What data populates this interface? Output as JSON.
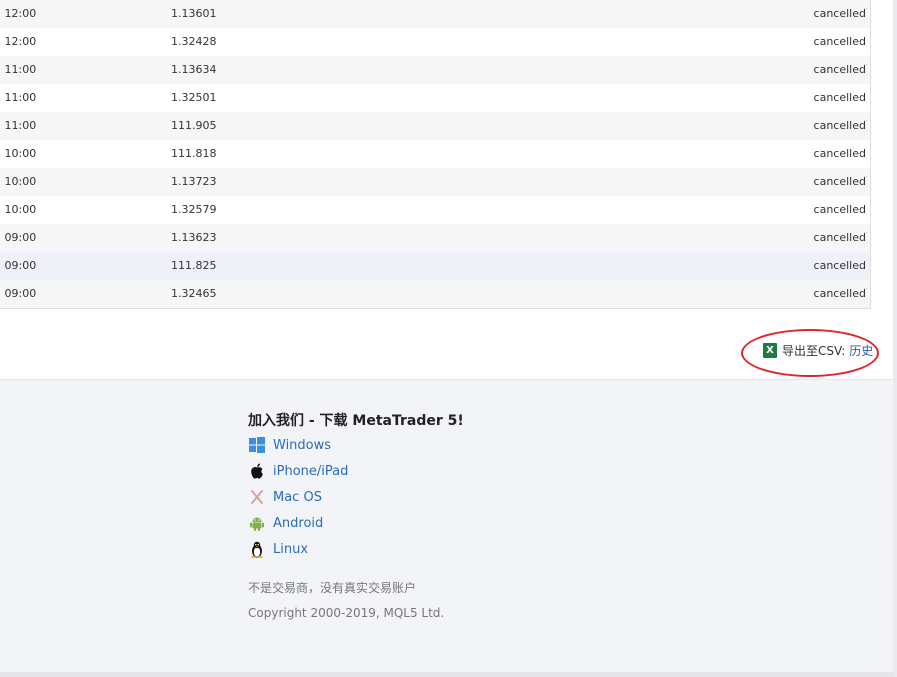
{
  "table": {
    "rows": [
      {
        "time": "1 12:00",
        "price": "1.13601",
        "status": "cancelled"
      },
      {
        "time": "1 12:00",
        "price": "1.32428",
        "status": "cancelled"
      },
      {
        "time": "1 11:00",
        "price": "1.13634",
        "status": "cancelled"
      },
      {
        "time": "1 11:00",
        "price": "1.32501",
        "status": "cancelled"
      },
      {
        "time": "1 11:00",
        "price": "111.905",
        "status": "cancelled"
      },
      {
        "time": "1 10:00",
        "price": "111.818",
        "status": "cancelled"
      },
      {
        "time": "1 10:00",
        "price": "1.13723",
        "status": "cancelled"
      },
      {
        "time": "1 10:00",
        "price": "1.32579",
        "status": "cancelled"
      },
      {
        "time": "1 09:00",
        "price": "1.13623",
        "status": "cancelled"
      },
      {
        "time": "1 09:00",
        "price": "111.825",
        "status": "cancelled"
      },
      {
        "time": "1 09:00",
        "price": "1.32465",
        "status": "cancelled"
      }
    ]
  },
  "export": {
    "icon": "excel-icon",
    "label": "导出至CSV:",
    "link": "历史"
  },
  "footer": {
    "title": "加入我们 - 下载 MetaTrader 5!",
    "platforms": [
      {
        "label": "Windows",
        "icon": "windows-icon"
      },
      {
        "label": "iPhone/iPad",
        "icon": "apple-icon"
      },
      {
        "label": "Mac OS",
        "icon": "macos-icon"
      },
      {
        "label": "Android",
        "icon": "android-icon"
      },
      {
        "label": "Linux",
        "icon": "linux-icon"
      }
    ],
    "disclaimer": "不是交易商，没有真实交易账户",
    "copyright": "Copyright 2000-2019, MQL5 Ltd."
  },
  "colors": {
    "link": "#2a6cb8",
    "highlight_circle": "#e0232f",
    "excel_green": "#1d7a43"
  }
}
